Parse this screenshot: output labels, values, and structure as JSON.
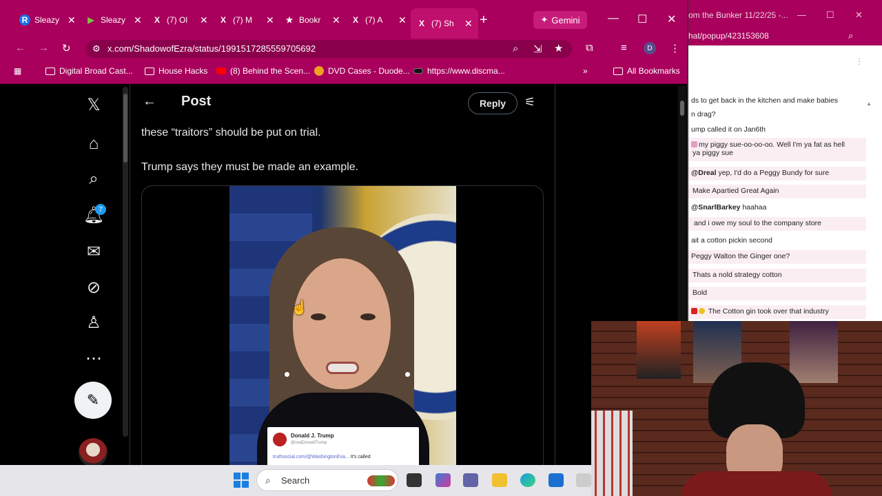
{
  "browser": {
    "tabs": [
      {
        "label": "Sleazy",
        "icon": "R",
        "icon_color": "#1a73e8"
      },
      {
        "label": "Sleazy",
        "icon": "▶",
        "icon_color": "#7fc242"
      },
      {
        "label": "(7) Ol",
        "icon": "X",
        "icon_color": "#ffffff"
      },
      {
        "label": "(7) M",
        "icon": "X",
        "icon_color": "#ffffff"
      },
      {
        "label": "Bookr",
        "icon": "★",
        "icon_color": "#ffffff"
      },
      {
        "label": "(7) A",
        "icon": "X",
        "icon_color": "#ffffff"
      },
      {
        "label": "(7) Sh",
        "icon": "X",
        "icon_color": "#ffffff"
      }
    ],
    "gemini_label": "Gemini",
    "url": "x.com/ShadowofEzra/status/1991517285559705692",
    "profile_initial": "D",
    "bookmarks": [
      {
        "label": "Digital Broad Cast...",
        "icon": "folder-icon"
      },
      {
        "label": "House Hacks",
        "icon": "folder-icon"
      },
      {
        "label": "(8) Behind the Scen...",
        "icon": "youtube-icon"
      },
      {
        "label": "DVD Cases - Duode...",
        "icon": "dvd-icon"
      },
      {
        "label": "https://www.discma...",
        "icon": "disc-icon"
      }
    ],
    "all_bookmarks_label": "All Bookmarks",
    "accent_color": "#a8005c"
  },
  "x": {
    "nav_icons": [
      "x-logo-icon",
      "home-icon",
      "search-icon",
      "bell-icon",
      "mail-icon",
      "grok-icon",
      "profile-icon",
      "more-icon"
    ],
    "notification_count": "7",
    "header_title": "Post",
    "reply_label": "Reply",
    "tweet_line1": "these “traitors” should be put on trial.",
    "tweet_line2": "Trump says they must be made an example.",
    "embedded_card": {
      "name": "Donald J. Trump",
      "handle": "@realDonaldTrump",
      "link": "truthsocial.com/@WashingtonExa...",
      "link_suffix": " It's called"
    }
  },
  "taskbar": {
    "search_label": "Search"
  },
  "chat": {
    "title": "om the Bunker 11/22/25 -...",
    "url": "hat/popup/423153608",
    "messages": [
      {
        "text": "ds to get back in the kitchen and make babies",
        "user": "",
        "pink": false
      },
      {
        "text": "n drag?",
        "user": "",
        "pink": false
      },
      {
        "text": "ump called it on Jan6th",
        "user": "",
        "pink": false
      },
      {
        "text": "my piggy sue-oo-oo-oo. Well I'm ya fat as hell",
        "user": "",
        "pink": true
      },
      {
        "text": "ya piggy sue",
        "user": "",
        "pink": true
      },
      {
        "text": "yep, I'd do a Peggy Bundy for sure",
        "user": "@Dreal",
        "pink": true
      },
      {
        "text": "Make Apartied Great Again",
        "user": "",
        "pink": true
      },
      {
        "text": "haahaa",
        "user": "@SnarlBarkey",
        "pink": false
      },
      {
        "text": "and i owe my soul to the company store",
        "user": "",
        "pink": true
      },
      {
        "text": "ait a cotton pickin second",
        "user": "",
        "pink": false
      },
      {
        "text": "Peggy Walton the Ginger one?",
        "user": "",
        "pink": true
      },
      {
        "text": "Thats a nold strategy cotton",
        "user": "",
        "pink": true
      },
      {
        "text": "Bold",
        "user": "",
        "pink": true
      },
      {
        "text": "The Cotton gin took over that industry",
        "user": "",
        "pink": true
      }
    ]
  }
}
